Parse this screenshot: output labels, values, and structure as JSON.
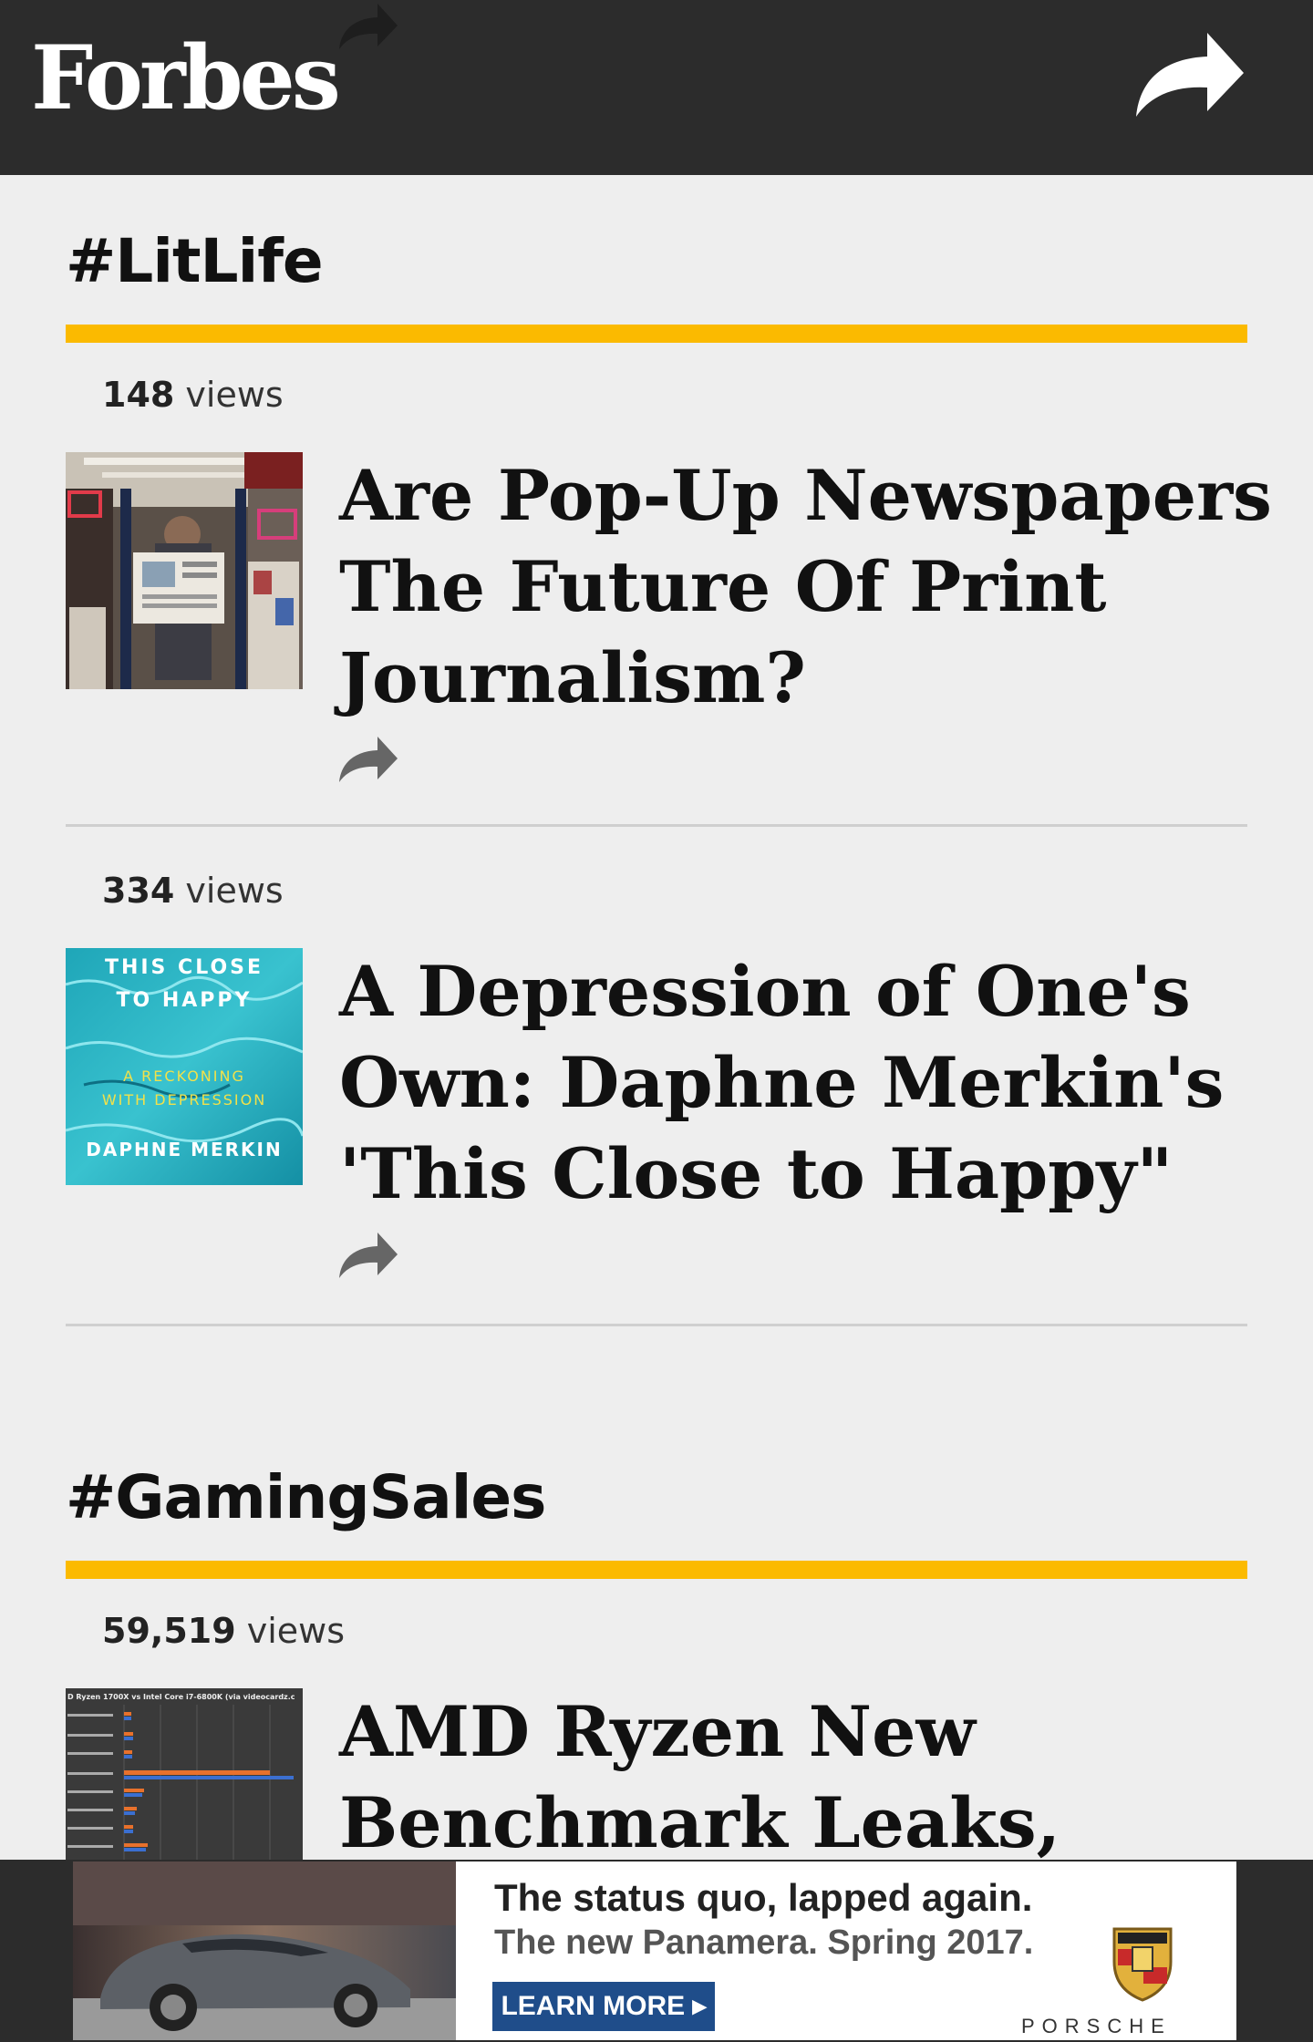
{
  "header": {
    "logo": "Forbes",
    "share_icon": "share-arrow-icon"
  },
  "sections": [
    {
      "title": "#LitLife",
      "articles": [
        {
          "views_count": "148",
          "views_label": "views",
          "headline": "Are Pop-Up Newspapers The Future Of Print Journalism?",
          "thumbnail": "man-reading-newspaper-in-newsstand-image"
        },
        {
          "views_count": "334",
          "views_label": "views",
          "headline": "A Depression of One's Own: Daphne Merkin's 'This Close to Happy\"",
          "thumbnail": {
            "title_line1": "THIS CLOSE",
            "title_line2": "TO HAPPY",
            "subtitle_line1": "A RECKONING",
            "subtitle_line2": "WITH DEPRESSION",
            "author": "DAPHNE MERKIN"
          }
        }
      ]
    },
    {
      "title": "#GamingSales",
      "articles": [
        {
          "views_count": "59,519",
          "views_label": "views",
          "headline": "AMD Ryzen New Benchmark Leaks, World",
          "thumbnail": {
            "chart_title": "D Ryzen 1700X vs Intel Core i7-6800K (via videocardz.c"
          }
        }
      ]
    }
  ],
  "ad": {
    "tagline": "The status quo, lapped again.",
    "subline": "The new Panamera. Spring 2017.",
    "cta": "LEARN MORE ▸",
    "brand": "PORSCHE"
  }
}
